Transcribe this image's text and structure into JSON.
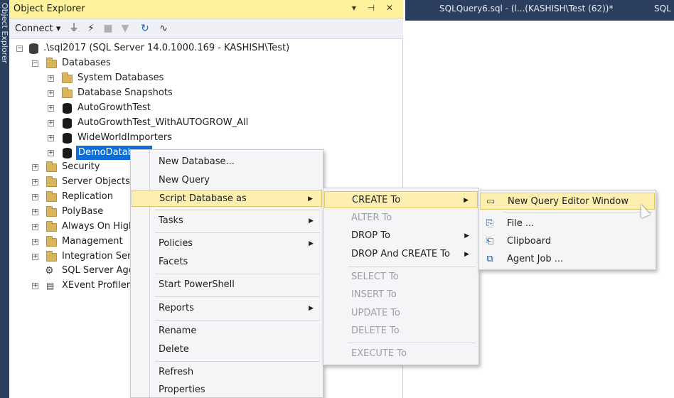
{
  "side_rail": {
    "label": "Object Explorer"
  },
  "object_explorer": {
    "title": "Object Explorer",
    "title_controls": "▾ ⊣ ✕",
    "toolbar": {
      "connect_label": "Connect ▾",
      "icons": [
        "connect-icon",
        "disconnect-icon",
        "stop-icon",
        "filter-icon",
        "refresh-icon",
        "activity-monitor-icon"
      ]
    },
    "server": ".\\sql2017 (SQL Server 14.0.1000.169 - KASHISH\\Test)",
    "tree": {
      "databases": "Databases",
      "system_databases": "System Databases",
      "database_snapshots": "Database Snapshots",
      "db1": "AutoGrowthTest",
      "db2": "AutoGrowthTest_WithAUTOGROW_All",
      "db3": "WideWorldImporters",
      "db4": "DemoDatabase",
      "security": "Security",
      "server_objects": "Server Objects",
      "replication": "Replication",
      "polybase": "PolyBase",
      "always_on": "Always On High Availability",
      "management": "Management",
      "integration": "Integration Services Catalogs",
      "sql_agent": "SQL Server Agent",
      "xevent": "XEvent Profiler"
    }
  },
  "query_tabs": {
    "tab1": "SQLQuery6.sql - (l...(KASHISH\\Test (62))*",
    "tab2": "SQL"
  },
  "context_menu": {
    "new_database": "New Database...",
    "new_query": "New Query",
    "script_database_as": "Script Database as",
    "tasks": "Tasks",
    "policies": "Policies",
    "facets": "Facets",
    "start_powershell": "Start PowerShell",
    "reports": "Reports",
    "rename": "Rename",
    "delete": "Delete",
    "refresh": "Refresh",
    "properties": "Properties"
  },
  "script_submenu": {
    "create_to": "CREATE To",
    "alter_to": "ALTER To",
    "drop_to": "DROP To",
    "drop_and_create_to": "DROP And CREATE To",
    "select_to": "SELECT To",
    "insert_to": "INSERT To",
    "update_to": "UPDATE To",
    "delete_to": "DELETE To",
    "execute_to": "EXECUTE To"
  },
  "create_submenu": {
    "new_query_editor_window": "New Query Editor Window",
    "file": "File ...",
    "clipboard": "Clipboard",
    "agent_job": "Agent Job ..."
  },
  "colors": {
    "panel_title": "#fff29d",
    "tab_strip": "#2c3e5e",
    "selection": "#0b6fd6",
    "menu_highlight": "#fcefb0"
  }
}
